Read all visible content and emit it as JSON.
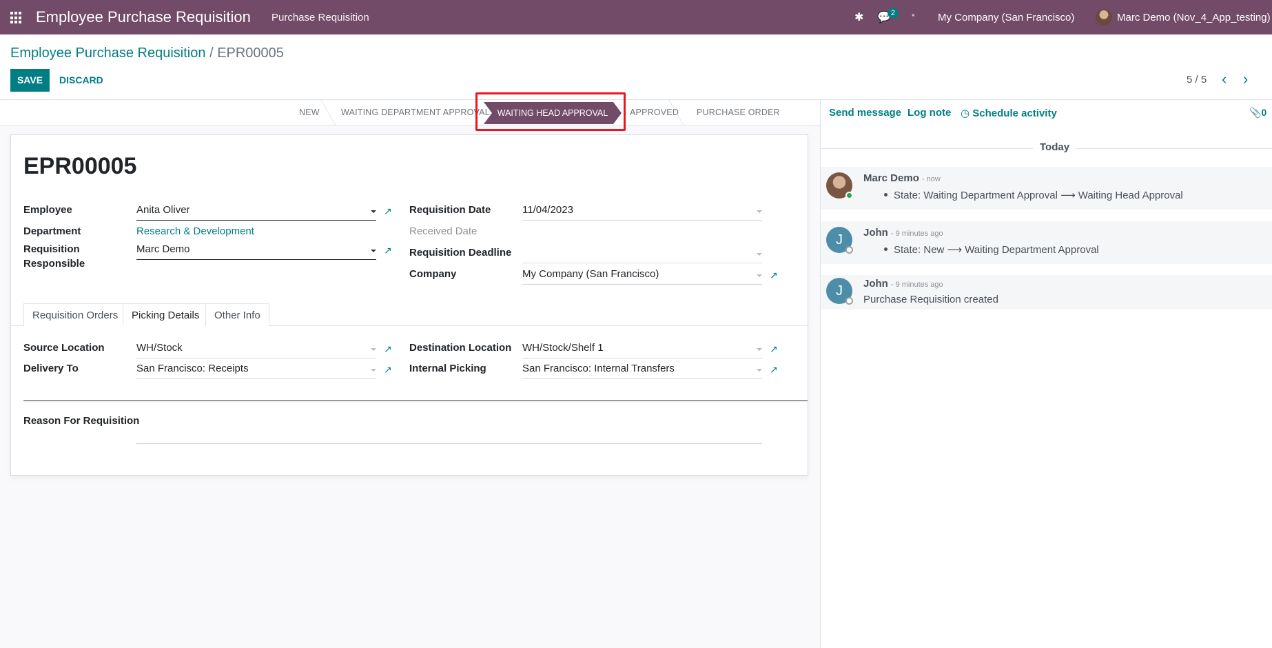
{
  "navbar": {
    "app_title": "Employee Purchase Requisition",
    "menu_item": "Purchase Requisition",
    "messages_count": "2",
    "company": "My Company (San Francisco)",
    "user": "Marc Demo (Nov_4_App_testing)",
    "accent_color": "#714b67"
  },
  "control_panel": {
    "breadcrumb_parent": "Employee Purchase Requisition",
    "breadcrumb_sep": "/",
    "breadcrumb_current": "EPR00005",
    "save_label": "SAVE",
    "discard_label": "DISCARD",
    "pager": "5 / 5"
  },
  "statusbar": {
    "stages": [
      "NEW",
      "WAITING DEPARTMENT APPROVAL",
      "WAITING HEAD APPROVAL",
      "APPROVED",
      "PURCHASE ORDER CREATED"
    ],
    "active_stage": "WAITING HEAD APPROVAL"
  },
  "record": {
    "name": "EPR00005",
    "employee_label": "Employee",
    "employee_value": "Anita Oliver",
    "department_label": "Department",
    "department_value": "Research & Development",
    "responsible_label_1": "Requisition",
    "responsible_label_2": "Responsible",
    "responsible_value": "Marc Demo",
    "req_date_label": "Requisition Date",
    "req_date_value": "11/04/2023",
    "received_date_label": "Received Date",
    "deadline_label": "Requisition Deadline",
    "deadline_value": "",
    "company_label": "Company",
    "company_value": "My Company (San Francisco)"
  },
  "tabs": [
    "Requisition Orders",
    "Picking Details",
    "Other Info"
  ],
  "picking": {
    "source_label": "Source Location",
    "source_value": "WH/Stock",
    "dest_label": "Destination Location",
    "dest_value": "WH/Stock/Shelf 1",
    "delivery_label": "Delivery To",
    "delivery_value": "San Francisco: Receipts",
    "internal_label": "Internal Picking",
    "internal_value": "San Francisco: Internal Transfers",
    "reason_label": "Reason For Requisition",
    "reason_value": ""
  },
  "chatter": {
    "send_message": "Send message",
    "log_note": "Log note",
    "schedule_activity": "Schedule activity",
    "attachments": "0",
    "date_divider": "Today",
    "messages": [
      {
        "author": "Marc Demo",
        "time": "- now",
        "body": "State: Waiting Department Approval ⟶ Waiting Head Approval"
      },
      {
        "author": "John",
        "time": "- 9 minutes ago",
        "body": "State: New ⟶ Waiting Department Approval"
      },
      {
        "author": "John",
        "time": "- 9 minutes ago",
        "body": "Purchase Requisition created"
      }
    ]
  }
}
